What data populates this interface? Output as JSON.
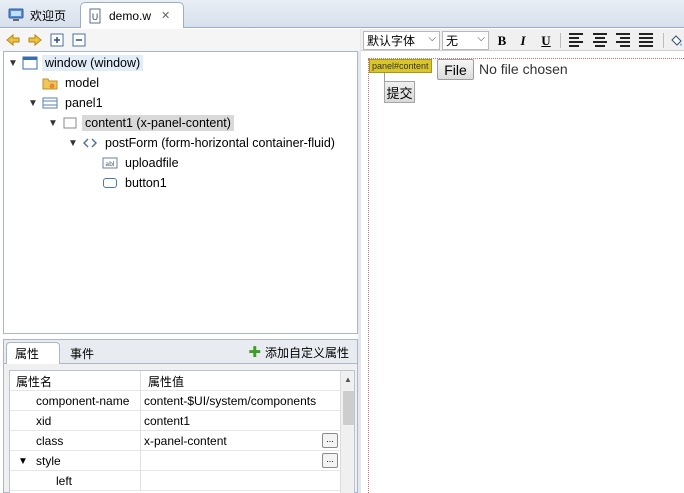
{
  "editor_tabs": [
    {
      "label": "欢迎页",
      "icon": "monitor-icon"
    },
    {
      "label": "demo.w",
      "icon": "w-file-icon",
      "close": "✕"
    }
  ],
  "outline": {
    "toolbar_icons": [
      "back-arrow-icon",
      "forward-arrow-icon",
      "expand-all-icon",
      "collapse-all-icon"
    ],
    "nodes": [
      {
        "label": "window (window)",
        "icon": "window-icon",
        "expanded": true,
        "selected": "highlight"
      },
      {
        "label": "model",
        "icon": "model-folder-icon"
      },
      {
        "label": "panel1",
        "icon": "panel-icon",
        "expanded": true
      },
      {
        "label": "content1 (x-panel-content)",
        "icon": "content-icon",
        "expanded": true,
        "selected": "active"
      },
      {
        "label": "postForm (form-horizontal container-fluid)",
        "icon": "code-icon",
        "expanded": true
      },
      {
        "label": "uploadfile",
        "icon": "input-field-icon"
      },
      {
        "label": "button1",
        "icon": "button-icon"
      }
    ]
  },
  "properties": {
    "tabs": [
      "属性",
      "事件"
    ],
    "add_custom": "添加自定义属性",
    "header": {
      "name": "属性名",
      "value": "属性值"
    },
    "rows": [
      {
        "name": "component-name",
        "value": "content-$UI/system/components"
      },
      {
        "name": "xid",
        "value": "content1"
      },
      {
        "name": "class",
        "value": "x-panel-content",
        "button": "..."
      },
      {
        "name": "style",
        "value": "",
        "button": "...",
        "expanded": true
      },
      {
        "name": "left",
        "value": ""
      }
    ]
  },
  "design_toolbar": {
    "font_family": "默认字体",
    "font_size": "无",
    "bold": "B",
    "italic": "I",
    "underline": "U"
  },
  "design": {
    "panel_tag": "panel#content",
    "file_button": "File",
    "file_status": "No file chosen",
    "submit_button": "提交"
  },
  "colors": {
    "selection_red": "#e46a6a",
    "panel_tag": "#d9c62b",
    "accent_blue": "#9aaec7"
  }
}
